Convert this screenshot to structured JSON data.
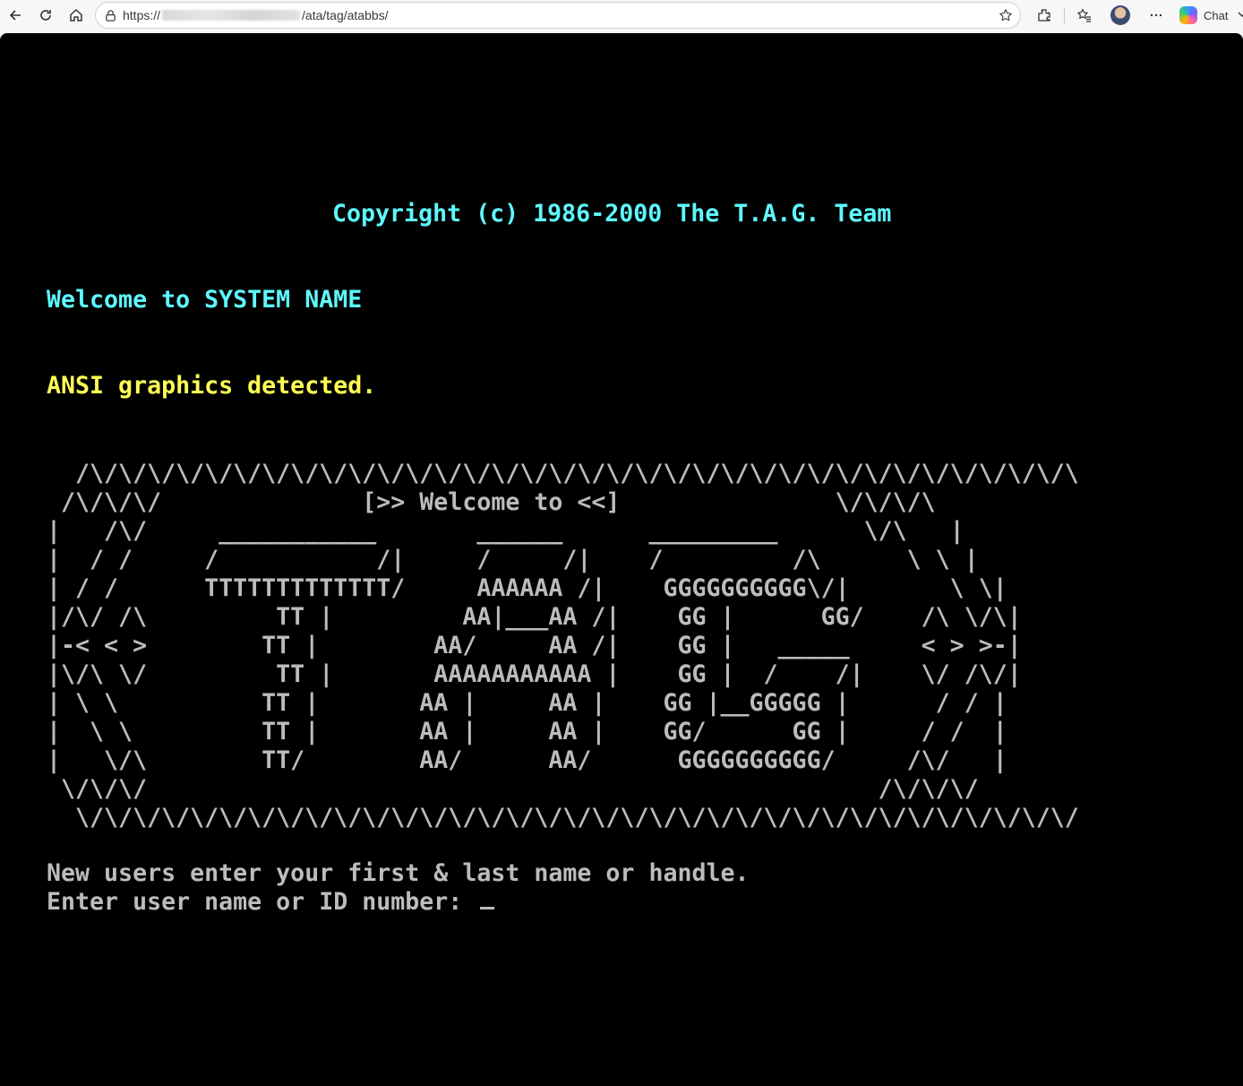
{
  "browser": {
    "url_scheme": "https://",
    "url_path": "/ata/tag/atabbs/",
    "chat_label": "Chat",
    "icons": {
      "back": "back-arrow-icon",
      "refresh": "refresh-icon",
      "home": "home-icon",
      "lock": "lock-icon",
      "favorite": "star-icon",
      "extensions": "puzzle-icon",
      "favorites": "favorites-icon",
      "more": "more-icon",
      "copilot": "copilot-icon",
      "chevron": "chevron-down-icon"
    }
  },
  "terminal": {
    "copyright": "Copyright (c) 1986-2000 The T.A.G. Team",
    "welcome": "Welcome to SYSTEM NAME",
    "ansi_detected": "ANSI graphics detected.",
    "banner": [
      "  /\\/\\/\\/\\/\\/\\/\\/\\/\\/\\/\\/\\/\\/\\/\\/\\/\\/\\/\\/\\/\\/\\/\\/\\/\\/\\/\\/\\/\\/\\/\\/\\/\\/\\/\\",
      " /\\/\\/\\/              [>> Welcome to <<]               \\/\\/\\/\\",
      "|   /\\/     ___________       ______      _________      \\/\\   |",
      "|  / /     /           /|     /     /|    /         /\\      \\ \\ |",
      "| / /      TTTTTTTTTTTTT/     AAAAAA /|    GGGGGGGGGG\\/|       \\ \\|",
      "|/\\/ /\\         TT |         AA|___AA /|    GG |      GG/    /\\ \\/\\|",
      "|-< < >        TT |        AA/     AA /|    GG |   _____     < > >-|",
      "|\\/\\ \\/         TT |       AAAAAAAAAAA |    GG |  /    /|    \\/ /\\/|",
      "| \\ \\          TT |       AA |     AA |    GG |__GGGGG |      / / |",
      "|  \\ \\         TT |       AA |     AA |    GG/      GG |     / /  |",
      "|   \\/\\        TT/        AA/      AA/      GGGGGGGGGG/     /\\/   |",
      " \\/\\/\\/                                                   /\\/\\/\\/",
      "  \\/\\/\\/\\/\\/\\/\\/\\/\\/\\/\\/\\/\\/\\/\\/\\/\\/\\/\\/\\/\\/\\/\\/\\/\\/\\/\\/\\/\\/\\/\\/\\/\\/\\/\\/"
    ],
    "new_users_prompt": "New users enter your first & last name or handle.",
    "login_prompt": "Enter user name or ID number: "
  }
}
